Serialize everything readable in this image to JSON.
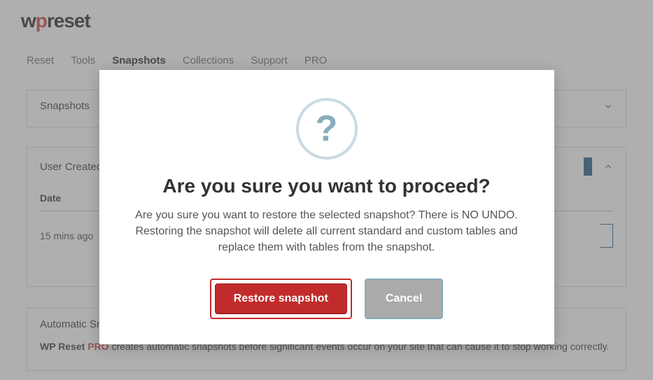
{
  "logo": {
    "prefix": "w",
    "mid": "p",
    "suffix": "reset"
  },
  "tabs": [
    "Reset",
    "Tools",
    "Snapshots",
    "Collections",
    "Support",
    "PRO"
  ],
  "active_tab_index": 2,
  "panel_snapshots": {
    "title": "Snapshots"
  },
  "panel_user": {
    "title": "User Created Snapsh",
    "col_date": "Date",
    "row_date": "15 mins ago"
  },
  "panel_auto": {
    "title": "Automatic Snapshots",
    "body_bold": "WP Reset",
    "body_pro": "PRO",
    "body_rest": " creates automatic snapshots before significant events occur on your site that can cause it to stop working correctly."
  },
  "modal": {
    "icon": "?",
    "title": "Are you sure you want to proceed?",
    "text": "Are you sure you want to restore the selected snapshot? There is NO UNDO. Restoring the snapshot will delete all current standard and custom tables and replace them with tables from the snapshot.",
    "primary": "Restore snapshot",
    "cancel": "Cancel"
  }
}
